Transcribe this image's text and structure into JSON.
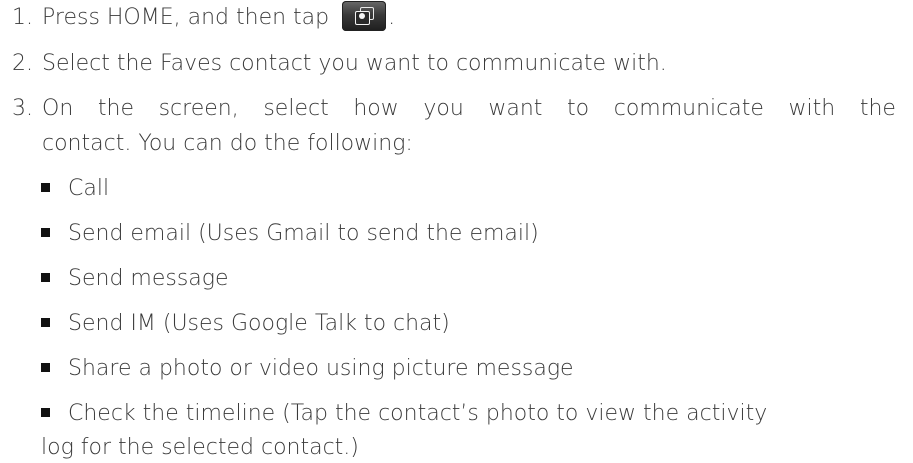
{
  "steps": {
    "step1": {
      "number": "1.",
      "text": "Press HOME, and then tap",
      "icon": "people-app-icon",
      "trailing": "."
    },
    "step2": {
      "number": "2.",
      "text": "Select the Faves contact you want to communicate with."
    },
    "step3": {
      "number": "3.",
      "line1_words": [
        "On",
        "the",
        "screen,",
        "select",
        "how",
        "you",
        "want",
        "to",
        "communicate",
        "with",
        "the"
      ],
      "line2": "contact. You can do the following:"
    }
  },
  "options": [
    "Call",
    "Send email (Uses Gmail to send the email)",
    "Send message",
    "Send IM (Uses Google Talk to chat)",
    "Share a photo or video using picture message",
    "Check the timeline (Tap the contact’s photo to view the activity"
  ],
  "option_continuation": "log for the selected contact.)"
}
